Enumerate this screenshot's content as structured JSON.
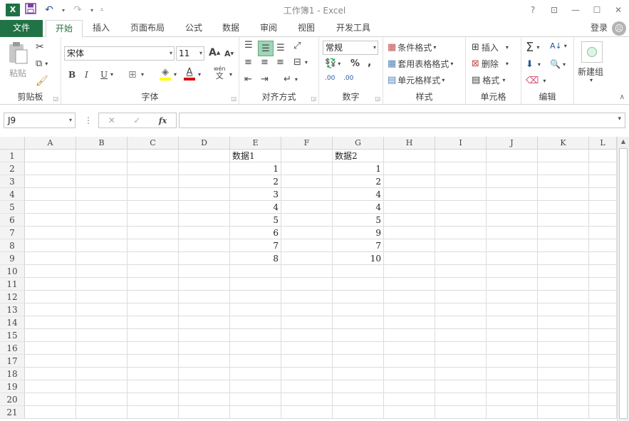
{
  "window": {
    "title": "工作簿1 - Excel",
    "help": "?",
    "ribbon_display": "⊡",
    "minimize": "—",
    "maximize": "☐",
    "close": "✕"
  },
  "qat": {
    "app_icon": "X",
    "save": "🖫",
    "undo": "↶",
    "redo": "↷",
    "dropdown": "▾",
    "customize": "⩡"
  },
  "tabs": [
    "文件",
    "开始",
    "插入",
    "页面布局",
    "公式",
    "数据",
    "审阅",
    "视图",
    "开发工具"
  ],
  "active_tab": "开始",
  "account": {
    "login": "登录",
    "avatar": "☹"
  },
  "ribbon": {
    "clipboard": {
      "label": "剪贴板",
      "paste": "粘贴"
    },
    "font": {
      "label": "字体",
      "name": "宋体",
      "size": "11",
      "bold": "B",
      "italic": "I",
      "underline": "U",
      "grow": "A",
      "shrink": "A",
      "phonetic_top": "wén",
      "phonetic_bottom": "文",
      "font_color": "A"
    },
    "alignment": {
      "label": "对齐方式"
    },
    "number": {
      "label": "数字",
      "format": "常规",
      "percent": "%",
      "comma": ",",
      "inc_decimal": ".00",
      "dec_decimal": ".00"
    },
    "styles": {
      "label": "样式",
      "conditional": "条件格式",
      "table": "套用表格格式",
      "cell_styles": "单元格样式"
    },
    "cells": {
      "label": "单元格",
      "insert": "插入",
      "delete": "删除",
      "format": "格式"
    },
    "editing": {
      "label": "编辑",
      "sum": "Σ",
      "sort": "A↓",
      "find": "🔍"
    },
    "newgroup": {
      "label": "新建组"
    }
  },
  "formula_bar": {
    "name_box": "J9",
    "cancel": "✕",
    "enter": "✓",
    "fx": "fx",
    "content": ""
  },
  "grid": {
    "columns": [
      "A",
      "B",
      "C",
      "D",
      "E",
      "F",
      "G",
      "H",
      "I",
      "J",
      "K",
      "L"
    ],
    "rows": [
      "1",
      "2",
      "3",
      "4",
      "5",
      "6",
      "7",
      "8",
      "9",
      "10",
      "11",
      "12",
      "13",
      "14",
      "15",
      "16",
      "17",
      "18",
      "19",
      "20",
      "21"
    ],
    "cells": [
      {
        "col": "E",
        "row": 1,
        "value": "数据1",
        "align": "left"
      },
      {
        "col": "G",
        "row": 1,
        "value": "数据2",
        "align": "left"
      },
      {
        "col": "E",
        "row": 2,
        "value": "1",
        "align": "right"
      },
      {
        "col": "E",
        "row": 3,
        "value": "2",
        "align": "right"
      },
      {
        "col": "E",
        "row": 4,
        "value": "3",
        "align": "right"
      },
      {
        "col": "E",
        "row": 5,
        "value": "4",
        "align": "right"
      },
      {
        "col": "E",
        "row": 6,
        "value": "5",
        "align": "right"
      },
      {
        "col": "E",
        "row": 7,
        "value": "6",
        "align": "right"
      },
      {
        "col": "E",
        "row": 8,
        "value": "7",
        "align": "right"
      },
      {
        "col": "E",
        "row": 9,
        "value": "8",
        "align": "right"
      },
      {
        "col": "G",
        "row": 2,
        "value": "1",
        "align": "right"
      },
      {
        "col": "G",
        "row": 3,
        "value": "2",
        "align": "right"
      },
      {
        "col": "G",
        "row": 4,
        "value": "4",
        "align": "right"
      },
      {
        "col": "G",
        "row": 5,
        "value": "4",
        "align": "right"
      },
      {
        "col": "G",
        "row": 6,
        "value": "5",
        "align": "right"
      },
      {
        "col": "G",
        "row": 7,
        "value": "9",
        "align": "right"
      },
      {
        "col": "G",
        "row": 8,
        "value": "7",
        "align": "right"
      },
      {
        "col": "G",
        "row": 9,
        "value": "10",
        "align": "right"
      }
    ]
  },
  "colors": {
    "accent": "#217346",
    "font_color_bar": "#e00000",
    "highlight_bar": "#ffff00"
  }
}
